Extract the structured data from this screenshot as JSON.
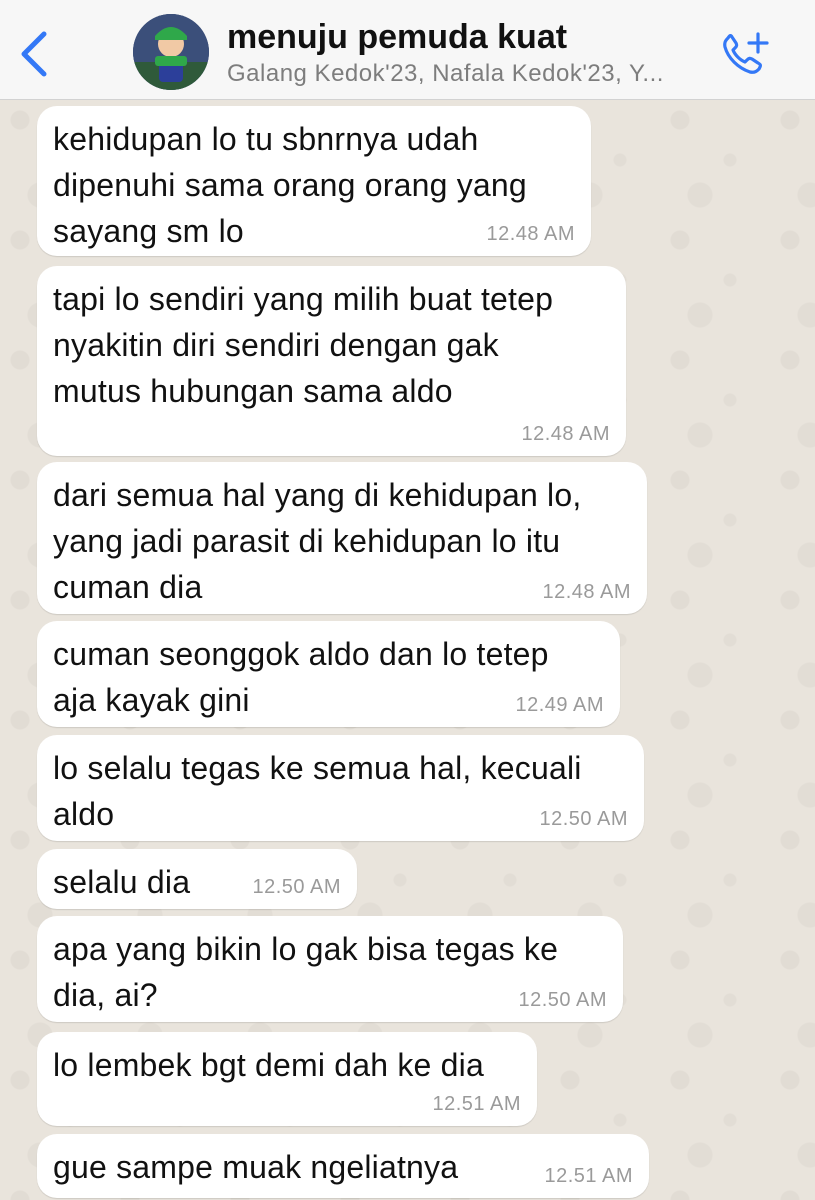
{
  "header": {
    "title": "menuju pemuda kuat",
    "subtitle": "Galang Kedok'23, Nafala Kedok'23, Y...",
    "back_icon": "chevron-left-icon",
    "call_icon": "add-call-icon",
    "accent_color": "#3478f6"
  },
  "messages": [
    {
      "text": "kehidupan lo tu sbnrnya udah\ndipenuhi sama orang orang yang\nsayang sm lo",
      "time": "12.48 AM"
    },
    {
      "text": "tapi lo sendiri yang milih buat tetep\nnyakitin diri sendiri dengan gak\nmutus hubungan sama aldo",
      "time": "12.48 AM"
    },
    {
      "text": "dari semua hal yang di kehidupan lo,\nyang jadi parasit di kehidupan lo itu\ncuman dia",
      "time": "12.48 AM"
    },
    {
      "text": "cuman seonggok aldo dan lo tetep\naja kayak gini",
      "time": "12.49 AM"
    },
    {
      "text": "lo selalu tegas ke semua hal, kecuali\naldo",
      "time": "12.50 AM"
    },
    {
      "text": "selalu dia",
      "time": "12.50 AM"
    },
    {
      "text": "apa yang bikin lo gak bisa tegas ke\ndia, ai?",
      "time": "12.50 AM"
    },
    {
      "text": "lo lembek bgt demi dah ke dia",
      "time": "12.51 AM"
    },
    {
      "text": "gue sampe muak ngeliatnya",
      "time": "12.51 AM"
    }
  ]
}
